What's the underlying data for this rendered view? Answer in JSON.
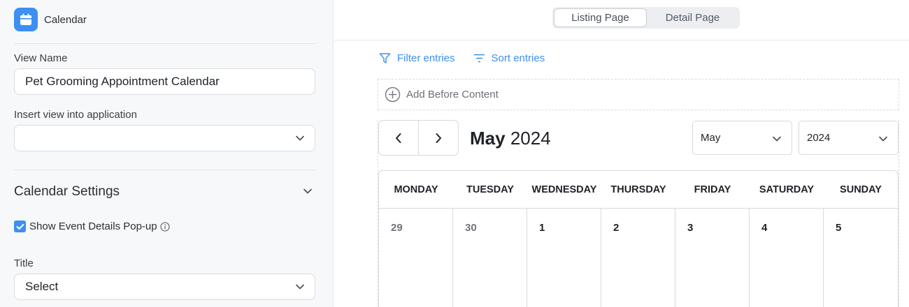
{
  "sidebar": {
    "app_name": "Calendar",
    "view_name_label": "View Name",
    "view_name_value": "Pet Grooming Appointment Calendar",
    "insert_label": "Insert view into application",
    "insert_value": "",
    "section_title": "Calendar Settings",
    "show_popup_label": "Show Event Details Pop-up",
    "show_popup_checked": true,
    "title_label": "Title",
    "title_value": "Select"
  },
  "main": {
    "tabs": [
      {
        "label": "Listing Page",
        "active": true
      },
      {
        "label": "Detail Page",
        "active": false
      }
    ],
    "filter_label": "Filter entries",
    "sort_label": "Sort entries",
    "add_before_label": "Add Before Content",
    "calendar": {
      "month_name": "May",
      "year": "2024",
      "month_select": "May",
      "year_select": "2024",
      "weekdays": [
        "MONDAY",
        "TUESDAY",
        "WEDNESDAY",
        "THURSDAY",
        "FRIDAY",
        "SATURDAY",
        "SUNDAY"
      ],
      "week1": [
        "29",
        "30",
        "1",
        "2",
        "3",
        "4",
        "5"
      ]
    }
  },
  "colors": {
    "accent": "#3d8ff2",
    "border": "#d6d9dd",
    "sidebar_bg": "#f7f8f9"
  },
  "icons": {
    "app": "calendar-icon",
    "filter": "filter-icon",
    "sort": "sort-icon",
    "add": "plus-circle-icon",
    "prev": "chevron-left-icon",
    "next": "chevron-right-icon",
    "info": "info-icon"
  }
}
